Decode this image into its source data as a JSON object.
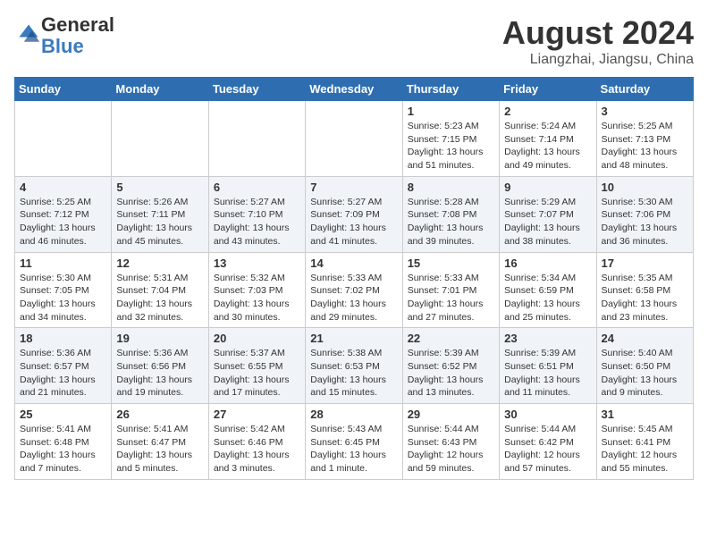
{
  "header": {
    "logo_general": "General",
    "logo_blue": "Blue",
    "month_year": "August 2024",
    "location": "Liangzhai, Jiangsu, China"
  },
  "weekdays": [
    "Sunday",
    "Monday",
    "Tuesday",
    "Wednesday",
    "Thursday",
    "Friday",
    "Saturday"
  ],
  "weeks": [
    [
      {
        "day": "",
        "info": ""
      },
      {
        "day": "",
        "info": ""
      },
      {
        "day": "",
        "info": ""
      },
      {
        "day": "",
        "info": ""
      },
      {
        "day": "1",
        "info": "Sunrise: 5:23 AM\nSunset: 7:15 PM\nDaylight: 13 hours\nand 51 minutes."
      },
      {
        "day": "2",
        "info": "Sunrise: 5:24 AM\nSunset: 7:14 PM\nDaylight: 13 hours\nand 49 minutes."
      },
      {
        "day": "3",
        "info": "Sunrise: 5:25 AM\nSunset: 7:13 PM\nDaylight: 13 hours\nand 48 minutes."
      }
    ],
    [
      {
        "day": "4",
        "info": "Sunrise: 5:25 AM\nSunset: 7:12 PM\nDaylight: 13 hours\nand 46 minutes."
      },
      {
        "day": "5",
        "info": "Sunrise: 5:26 AM\nSunset: 7:11 PM\nDaylight: 13 hours\nand 45 minutes."
      },
      {
        "day": "6",
        "info": "Sunrise: 5:27 AM\nSunset: 7:10 PM\nDaylight: 13 hours\nand 43 minutes."
      },
      {
        "day": "7",
        "info": "Sunrise: 5:27 AM\nSunset: 7:09 PM\nDaylight: 13 hours\nand 41 minutes."
      },
      {
        "day": "8",
        "info": "Sunrise: 5:28 AM\nSunset: 7:08 PM\nDaylight: 13 hours\nand 39 minutes."
      },
      {
        "day": "9",
        "info": "Sunrise: 5:29 AM\nSunset: 7:07 PM\nDaylight: 13 hours\nand 38 minutes."
      },
      {
        "day": "10",
        "info": "Sunrise: 5:30 AM\nSunset: 7:06 PM\nDaylight: 13 hours\nand 36 minutes."
      }
    ],
    [
      {
        "day": "11",
        "info": "Sunrise: 5:30 AM\nSunset: 7:05 PM\nDaylight: 13 hours\nand 34 minutes."
      },
      {
        "day": "12",
        "info": "Sunrise: 5:31 AM\nSunset: 7:04 PM\nDaylight: 13 hours\nand 32 minutes."
      },
      {
        "day": "13",
        "info": "Sunrise: 5:32 AM\nSunset: 7:03 PM\nDaylight: 13 hours\nand 30 minutes."
      },
      {
        "day": "14",
        "info": "Sunrise: 5:33 AM\nSunset: 7:02 PM\nDaylight: 13 hours\nand 29 minutes."
      },
      {
        "day": "15",
        "info": "Sunrise: 5:33 AM\nSunset: 7:01 PM\nDaylight: 13 hours\nand 27 minutes."
      },
      {
        "day": "16",
        "info": "Sunrise: 5:34 AM\nSunset: 6:59 PM\nDaylight: 13 hours\nand 25 minutes."
      },
      {
        "day": "17",
        "info": "Sunrise: 5:35 AM\nSunset: 6:58 PM\nDaylight: 13 hours\nand 23 minutes."
      }
    ],
    [
      {
        "day": "18",
        "info": "Sunrise: 5:36 AM\nSunset: 6:57 PM\nDaylight: 13 hours\nand 21 minutes."
      },
      {
        "day": "19",
        "info": "Sunrise: 5:36 AM\nSunset: 6:56 PM\nDaylight: 13 hours\nand 19 minutes."
      },
      {
        "day": "20",
        "info": "Sunrise: 5:37 AM\nSunset: 6:55 PM\nDaylight: 13 hours\nand 17 minutes."
      },
      {
        "day": "21",
        "info": "Sunrise: 5:38 AM\nSunset: 6:53 PM\nDaylight: 13 hours\nand 15 minutes."
      },
      {
        "day": "22",
        "info": "Sunrise: 5:39 AM\nSunset: 6:52 PM\nDaylight: 13 hours\nand 13 minutes."
      },
      {
        "day": "23",
        "info": "Sunrise: 5:39 AM\nSunset: 6:51 PM\nDaylight: 13 hours\nand 11 minutes."
      },
      {
        "day": "24",
        "info": "Sunrise: 5:40 AM\nSunset: 6:50 PM\nDaylight: 13 hours\nand 9 minutes."
      }
    ],
    [
      {
        "day": "25",
        "info": "Sunrise: 5:41 AM\nSunset: 6:48 PM\nDaylight: 13 hours\nand 7 minutes."
      },
      {
        "day": "26",
        "info": "Sunrise: 5:41 AM\nSunset: 6:47 PM\nDaylight: 13 hours\nand 5 minutes."
      },
      {
        "day": "27",
        "info": "Sunrise: 5:42 AM\nSunset: 6:46 PM\nDaylight: 13 hours\nand 3 minutes."
      },
      {
        "day": "28",
        "info": "Sunrise: 5:43 AM\nSunset: 6:45 PM\nDaylight: 13 hours\nand 1 minute."
      },
      {
        "day": "29",
        "info": "Sunrise: 5:44 AM\nSunset: 6:43 PM\nDaylight: 12 hours\nand 59 minutes."
      },
      {
        "day": "30",
        "info": "Sunrise: 5:44 AM\nSunset: 6:42 PM\nDaylight: 12 hours\nand 57 minutes."
      },
      {
        "day": "31",
        "info": "Sunrise: 5:45 AM\nSunset: 6:41 PM\nDaylight: 12 hours\nand 55 minutes."
      }
    ]
  ]
}
